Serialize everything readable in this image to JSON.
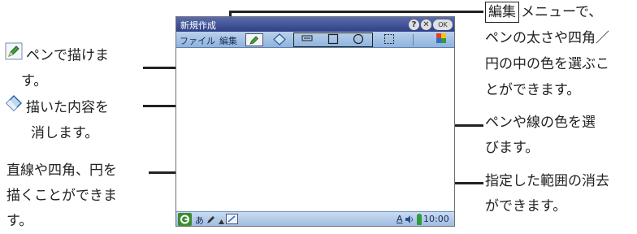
{
  "window": {
    "title": "新規作成",
    "help_glyph": "?",
    "close_glyph": "✕",
    "ok_label": "OK"
  },
  "menubar": {
    "file": "ファイル",
    "edit": "編集"
  },
  "statusbar": {
    "kana": "あ",
    "input": "A",
    "time": "10:00 AM"
  },
  "callouts": {
    "pen_line1": "ペンで描けま",
    "pen_line2": "す。",
    "eraser_line1": "描いた内容を",
    "eraser_line2": "消します。",
    "shapes_line1": "直線や四角、円を",
    "shapes_line2": "描くことができま",
    "shapes_line3": "す。",
    "edit_word": "編集",
    "edit_line1": "メニューで、",
    "edit_line2": "ペンの太さや四角／",
    "edit_line3": "円の中の色を選ぶこ",
    "edit_line4": "とができます。",
    "color_line1": "ペンや線の色を選",
    "color_line2": "びます。",
    "select_line1": "指定した範囲の消去",
    "select_line2": "ができます。"
  }
}
